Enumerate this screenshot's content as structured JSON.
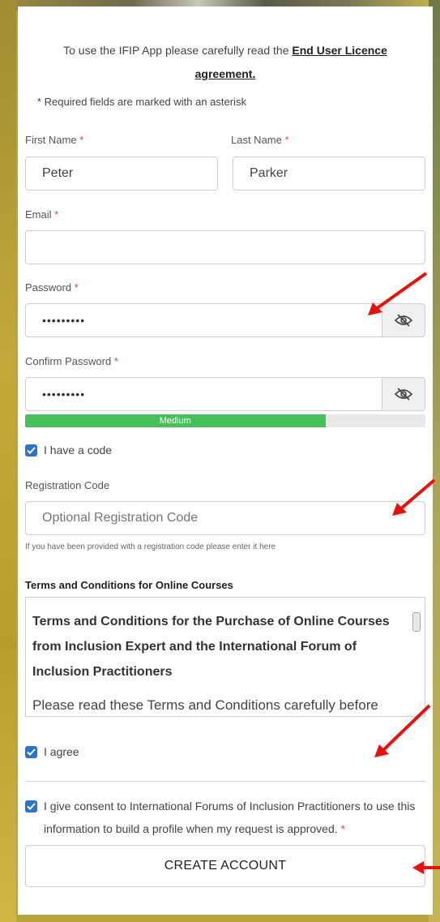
{
  "intro": {
    "text": "To use the IFIP App please carefully read the ",
    "link_line1": "End User Licence",
    "link_line2": "agreement."
  },
  "required_note": "* Required fields are marked with an asterisk",
  "required_marker": "*",
  "first_name": {
    "label": "First Name",
    "value": "Peter"
  },
  "last_name": {
    "label": "Last Name",
    "value": "Parker"
  },
  "email": {
    "label": "Email",
    "value": ""
  },
  "password": {
    "label": "Password",
    "value": "•••••••••",
    "toggle_icon": "eye-off-icon"
  },
  "confirm_password": {
    "label": "Confirm Password",
    "value": "•••••••••",
    "toggle_icon": "eye-off-icon"
  },
  "strength": {
    "label": "Medium",
    "level_percent": 75,
    "color": "#45c05a"
  },
  "have_code": {
    "label": "I have a code",
    "checked": true
  },
  "registration_code": {
    "label": "Registration Code",
    "placeholder": "Optional Registration Code",
    "help": "If you have been provided with a registration code please enter it here"
  },
  "terms": {
    "section_title": "Terms and Conditions for Online Courses",
    "heading": "Terms and Conditions for the Purchase of Online Courses from Inclusion Expert and the International Forum of Inclusion Practitioners",
    "body": "Please read these Terms and Conditions carefully before"
  },
  "agree": {
    "label": "I agree",
    "checked": true
  },
  "consent": {
    "label": "I give consent to International Forums of Inclusion Practitioners to use this information to build a profile when my request is approved.",
    "checked": true
  },
  "create_button": "CREATE ACCOUNT",
  "colors": {
    "accent": "#2a74c9",
    "required": "#e04a4a",
    "annotation_arrow": "#e8120c"
  }
}
